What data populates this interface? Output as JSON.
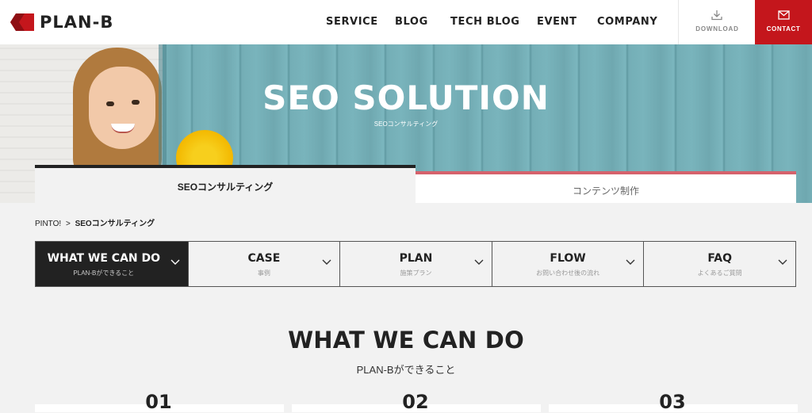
{
  "header": {
    "logo_text": "PLAN-B",
    "nav": [
      "SERVICE",
      "BLOG",
      "TECH BLOG",
      "EVENT",
      "COMPANY"
    ],
    "download_label": "DOWNLOAD",
    "contact_label": "CONTACT",
    "accent_color": "#c4161c"
  },
  "hero": {
    "title": "SEO SOLUTION",
    "subtitle": "SEOコンサルティング"
  },
  "tabs": [
    {
      "label": "SEOコンサルティング",
      "active": true
    },
    {
      "label": "コンテンツ制作",
      "active": false
    }
  ],
  "breadcrumb": {
    "root": "PINTO!",
    "separator": ">",
    "current": "SEOコンサルティング"
  },
  "section_nav": [
    {
      "title": "WHAT WE CAN DO",
      "sub": "PLAN-Bができること",
      "active": true
    },
    {
      "title": "CASE",
      "sub": "事例",
      "active": false
    },
    {
      "title": "PLAN",
      "sub": "施策プラン",
      "active": false
    },
    {
      "title": "FLOW",
      "sub": "お問い合わせ後の流れ",
      "active": false
    },
    {
      "title": "FAQ",
      "sub": "よくあるご質問",
      "active": false
    }
  ],
  "section": {
    "title": "WHAT WE CAN DO",
    "subtitle": "PLAN-Bができること",
    "cards": [
      "01",
      "02",
      "03"
    ]
  }
}
